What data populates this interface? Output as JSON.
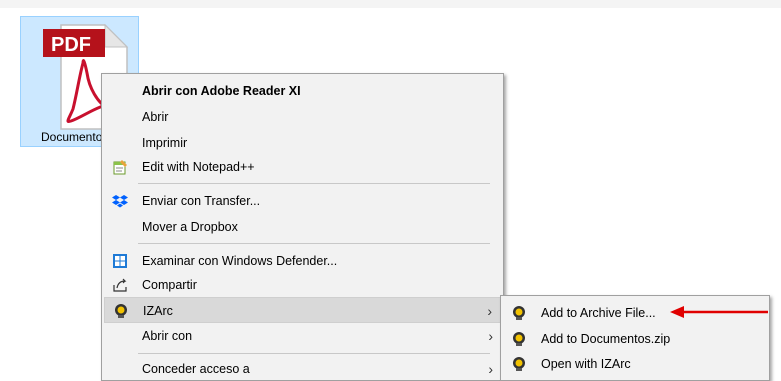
{
  "desktop": {
    "file": {
      "badge": "PDF",
      "label": "Documentos",
      "icon": "pdf-file-icon"
    }
  },
  "context_menu": {
    "items": [
      {
        "label": "Abrir con Adobe Reader XI",
        "bold": true
      },
      {
        "label": "Abrir"
      },
      {
        "label": "Imprimir"
      },
      {
        "label": "Edit with Notepad++",
        "icon": "notepadpp-icon"
      },
      {
        "label": "Enviar con Transfer...",
        "icon": "dropbox-icon"
      },
      {
        "label": "Mover a Dropbox"
      },
      {
        "label": "Examinar con Windows Defender...",
        "icon": "windows-defender-icon"
      },
      {
        "label": "Compartir",
        "icon": "share-icon"
      },
      {
        "label": "IZArc",
        "icon": "izarc-icon",
        "submenu": true,
        "highlighted": true
      },
      {
        "label": "Abrir con",
        "submenu": true
      },
      {
        "label": "Conceder acceso a",
        "submenu": true
      }
    ],
    "chevron": "›"
  },
  "submenu": {
    "items": [
      {
        "label": "Add to Archive File...",
        "icon": "izarc-icon"
      },
      {
        "label": "Add to Documentos.zip",
        "icon": "izarc-icon"
      },
      {
        "label": "Open with IZArc",
        "icon": "izarc-icon"
      }
    ]
  },
  "colors": {
    "selection_bg": "#cce8ff",
    "menu_bg": "#f2f2f2",
    "highlight_bg": "#d9d9d9",
    "annotation_arrow": "#e00000",
    "pdf_red": "#c8102e"
  }
}
